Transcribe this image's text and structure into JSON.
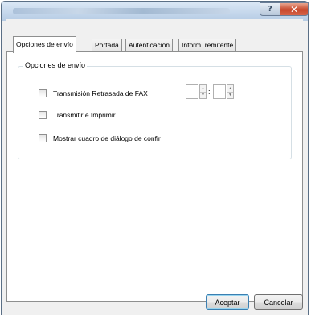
{
  "window": {
    "help_glyph": "?",
    "close_glyph": "✕"
  },
  "tabs": [
    {
      "label": "Opciones de envío",
      "active": true
    },
    {
      "label": "Portada",
      "active": false
    },
    {
      "label": "Autenticación",
      "active": false
    },
    {
      "label": "Inform. remitente",
      "active": false
    }
  ],
  "group": {
    "legend": "Opciones de envío",
    "options": [
      {
        "label": "Transmisión Retrasada de FAX",
        "checked": false
      },
      {
        "label": "Transmitir e Imprimir",
        "checked": false
      },
      {
        "label": "Mostrar cuadro de diálogo de confir",
        "checked": false
      }
    ],
    "time_separator": ":",
    "hours_value": "",
    "minutes_value": ""
  },
  "buttons": {
    "accept": "Aceptar",
    "cancel": "Cancelar"
  }
}
